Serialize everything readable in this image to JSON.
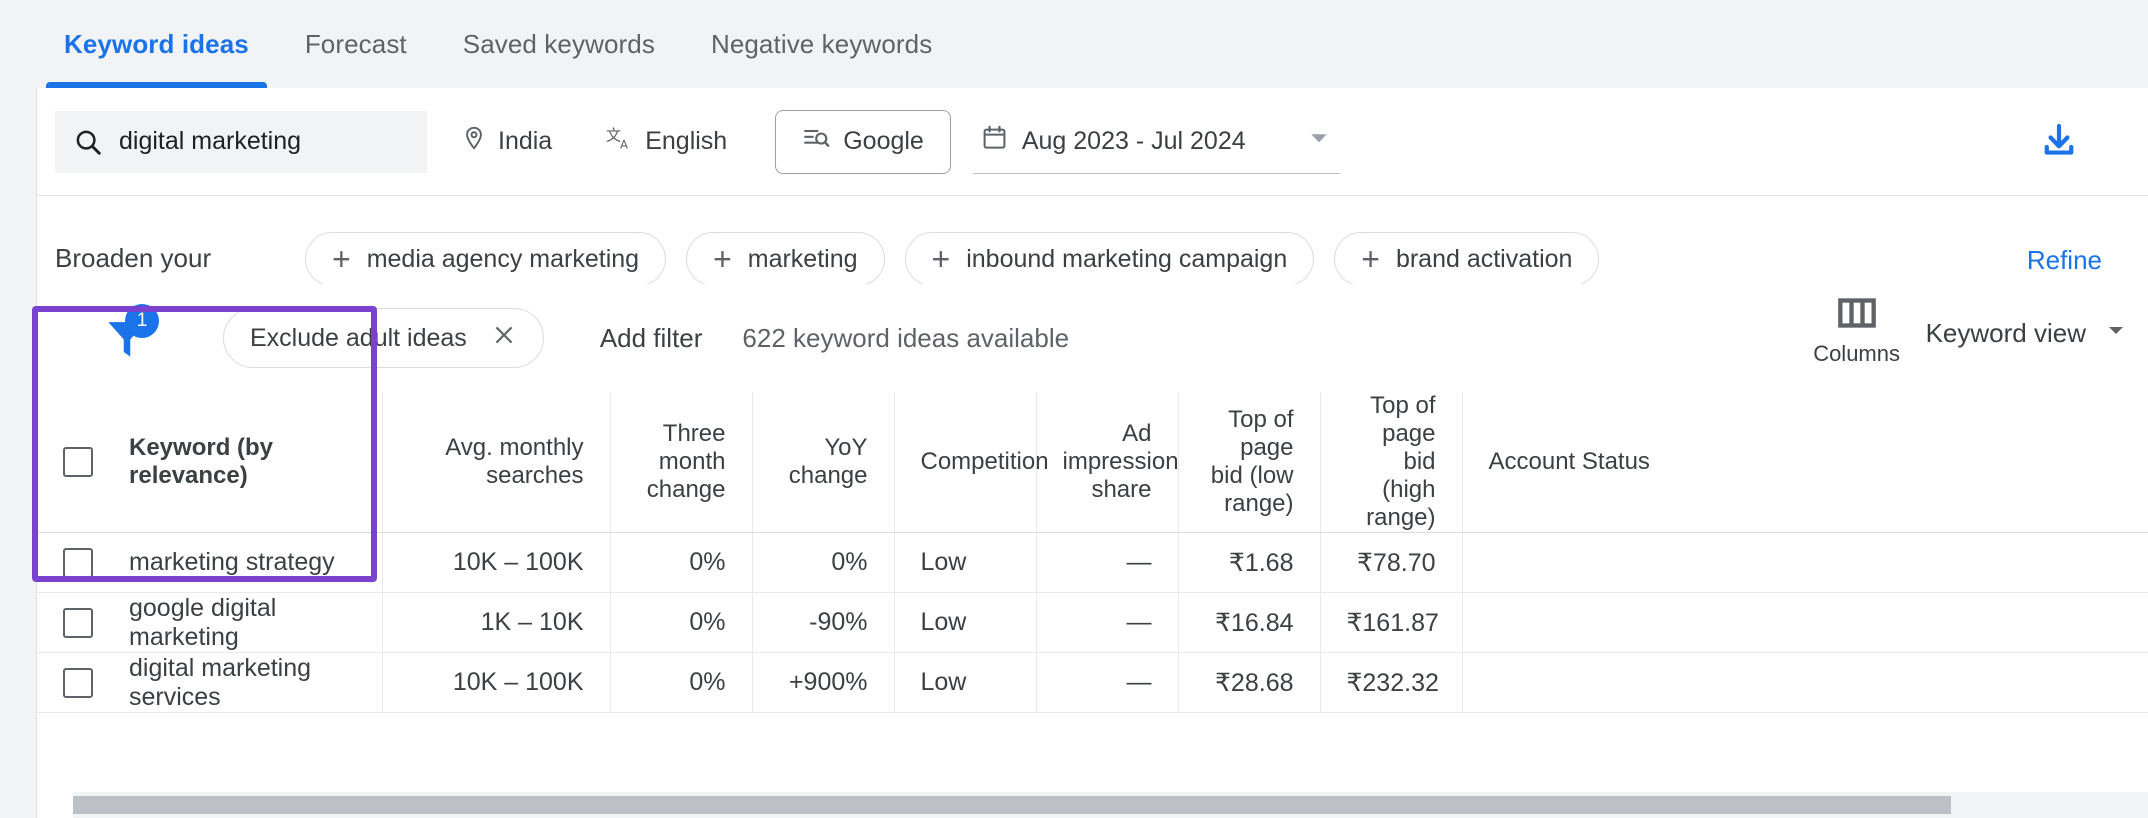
{
  "tabs": [
    {
      "label": "Keyword ideas",
      "active": true
    },
    {
      "label": "Forecast",
      "active": false
    },
    {
      "label": "Saved keywords",
      "active": false
    },
    {
      "label": "Negative keywords",
      "active": false
    }
  ],
  "search": {
    "value": "digital marketing",
    "icon": "search-icon",
    "location": "India",
    "location_icon": "location-pin-icon",
    "language": "English",
    "language_icon": "translate-icon",
    "network": "Google",
    "network_icon": "search-network-icon",
    "date_range": "Aug 2023 - Jul 2024",
    "date_icon": "calendar-icon",
    "download_icon": "download-icon"
  },
  "broaden": {
    "label": "Broaden your",
    "chips": [
      "media agency marketing",
      "marketing",
      "inbound marketing campaign",
      "brand activation"
    ],
    "refine": "Refine"
  },
  "filterbar": {
    "funnel_icon": "filter-funnel-icon",
    "funnel_badge": "1",
    "active_filter": "Exclude adult ideas",
    "remove_icon": "close-icon",
    "add_filter": "Add filter",
    "available": "622 keyword ideas available",
    "columns_icon": "columns-icon",
    "columns_label": "Columns",
    "view_label": "Keyword view",
    "view_caret": "chevron-down-icon"
  },
  "table": {
    "columns": [
      "Keyword (by relevance)",
      "Avg. monthly searches",
      "Three month change",
      "YoY change",
      "Competition",
      "Ad impression share",
      "Top of page bid (low range)",
      "Top of page bid (high range)",
      "Account Status"
    ],
    "rows": [
      {
        "keyword": "marketing strategy",
        "avg_monthly_searches": "10K – 100K",
        "three_month_change": "0%",
        "yoy_change": "0%",
        "competition": "Low",
        "ad_impression_share": "—",
        "bid_low": "₹1.68",
        "bid_high": "₹78.70",
        "account_status": ""
      },
      {
        "keyword": "google digital marketing",
        "avg_monthly_searches": "1K – 10K",
        "three_month_change": "0%",
        "yoy_change": "-90%",
        "competition": "Low",
        "ad_impression_share": "—",
        "bid_low": "₹16.84",
        "bid_high": "₹161.87",
        "account_status": ""
      },
      {
        "keyword": "digital marketing services",
        "avg_monthly_searches": "10K – 100K",
        "three_month_change": "0%",
        "yoy_change": "+900%",
        "competition": "Low",
        "ad_impression_share": "—",
        "bid_low": "₹28.68",
        "bid_high": "₹232.32",
        "account_status": ""
      }
    ]
  },
  "colors": {
    "accent_blue": "#1a73e8",
    "highlight_purple": "#7b42cf",
    "text_primary": "#3c4043",
    "text_secondary": "#5f6368",
    "page_bg": "#f1f3f4"
  }
}
